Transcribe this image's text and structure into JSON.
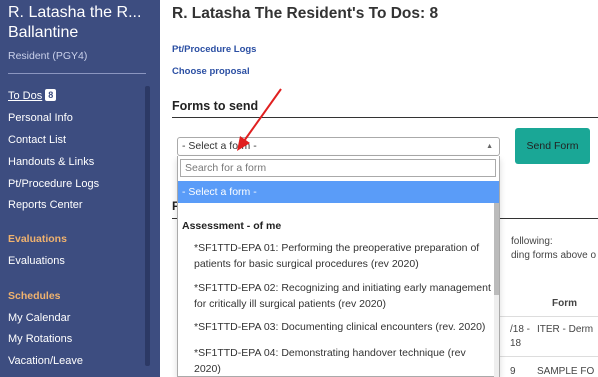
{
  "sidebar": {
    "user_name": "R. Latasha the R... Ballantine",
    "role": "Resident (PGY4)",
    "nav": [
      {
        "label": "To Dos",
        "badge": "8",
        "active": true
      },
      {
        "label": "Personal Info"
      },
      {
        "label": "Contact List"
      },
      {
        "label": "Handouts & Links"
      },
      {
        "label": "Pt/Procedure Logs"
      },
      {
        "label": "Reports Center"
      }
    ],
    "sections": [
      {
        "title": "Evaluations",
        "items": [
          "Evaluations"
        ]
      },
      {
        "title": "Schedules",
        "items": [
          "My Calendar",
          "My Rotations",
          "Vacation/Leave"
        ]
      }
    ],
    "colors": {
      "background": "#3d4d80",
      "section": "#f0b26e"
    }
  },
  "main": {
    "title": "R. Latasha The Resident's To Dos: 8",
    "links": [
      "Pt/Procedure Logs",
      "Choose proposal"
    ],
    "forms_heading": "Forms to send",
    "select": {
      "value": "- Select a form -"
    },
    "send_button": "Send Form",
    "dropdown": {
      "search_placeholder": "Search for a form",
      "selected": "- Select a form -",
      "group": "Assessment - of me",
      "options": [
        "*SF1TTD-EPA 01: Performing the preoperative preparation of patients for basic surgical procedures (rev 2020)",
        "*SF1TTD-EPA 02: Recognizing and initiating early management for critically ill surgical patients (rev 2020)",
        "*SF1TTD-EPA 03: Documenting clinical encounters (rev. 2020)",
        "*SF1TTD-EPA 04: Demonstrating handover technique (rev 2020)"
      ]
    },
    "background": {
      "heading_fragment": "F",
      "text1": "following:",
      "text2": "ding forms above o",
      "col_header": "Form",
      "row1_a": "/18 -",
      "row1_b": "18",
      "row1_form": "ITER - Derm",
      "row2_a": "9",
      "row2_form": "SAMPLE FO"
    },
    "colors": {
      "send_button": "#1aa796",
      "dropdown_highlight": "#5a9cf8",
      "link": "#2b4fa3",
      "annotation_arrow": "#e02020"
    }
  }
}
